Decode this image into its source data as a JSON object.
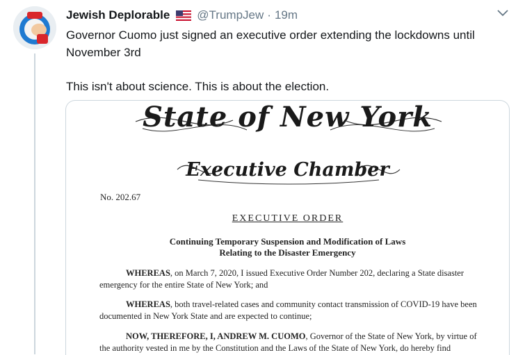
{
  "tweet": {
    "display_name": "Jewish Deplorable",
    "flag_icon": "us-flag-icon",
    "handle": "@TrumpJew",
    "separator": "·",
    "timestamp": "19m",
    "text_line1": "Governor Cuomo just signed an executive order extending the lockdowns until November 3rd",
    "text_line2": "This isn't about science. This is about the election."
  },
  "media": {
    "doc_title": "State of New York",
    "doc_subtitle": "Executive Chamber",
    "doc_number": "No. 202.67",
    "doc_order_label": "EXECUTIVE ORDER",
    "doc_heading_line1": "Continuing Temporary Suspension and Modification of Laws",
    "doc_heading_line2": "Relating to the Disaster Emergency",
    "para1_lead": "WHEREAS",
    "para1_text": ", on March 7, 2020, I issued Executive Order Number 202, declaring a State disaster emergency for the entire State of New York; and",
    "para2_lead": "WHEREAS",
    "para2_text": ", both travel-related cases and community contact transmission of COVID-19 have been documented in New York State and are expected to continue;",
    "para3_lead": "NOW, THEREFORE, I, ANDREW M. CUOMO",
    "para3_text": ", Governor of the State of New York, by virtue of the authority vested in me by the Constitution and the Laws of the State of New York, do hereby find"
  },
  "colors": {
    "text": "#14171a",
    "secondary": "#657786",
    "border": "#ccd6dd"
  }
}
